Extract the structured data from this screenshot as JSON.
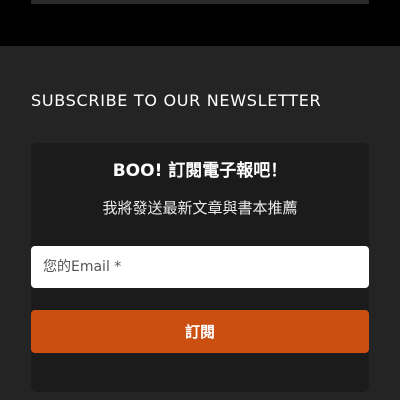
{
  "newsletter": {
    "heading": "SUBSCRIBE TO OUR NEWSLETTER",
    "title": "BOO! 訂閱電子報吧！",
    "subtitle": "我將發送最新文章與書本推薦",
    "email_placeholder": "您的Email *",
    "email_value": "",
    "subscribe_label": "訂閱"
  },
  "colors": {
    "page_background": "#242424",
    "top_band": "#000000",
    "card_background": "#1b1b1b",
    "button_accent": "#cc4f12",
    "input_background": "#ffffff"
  }
}
